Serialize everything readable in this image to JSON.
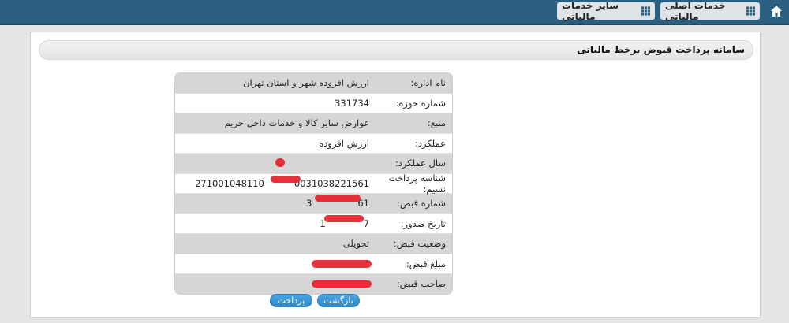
{
  "nav": {
    "main_services": "خدمات اصلی مالیاتی",
    "other_services": "سایر خدمات مالیاتی"
  },
  "panel": {
    "title": "سامانه پرداخت قبوض برخط مالیاتی"
  },
  "fields": [
    {
      "label": "نام اداره:",
      "value": "ارزش افزوده شهر و استان تهران"
    },
    {
      "label": "شماره حوزه:",
      "value": "331734"
    },
    {
      "label": "منبع:",
      "value": "عوارض سایر کالا و خدمات داخل حریم"
    },
    {
      "label": "عملکرد:",
      "value": "ارزش افزوده"
    },
    {
      "label": "سال عملکرد:",
      "value": ""
    },
    {
      "label": "شناسه پرداخت نسیم:",
      "value": "271001048110",
      "value_tail": "0031038221561"
    },
    {
      "label": "شماره قبض:",
      "value": "3",
      "value_tail": "61"
    },
    {
      "label": "تاریخ صدور:",
      "value": "1",
      "value_tail": "7"
    },
    {
      "label": "وضعیت قبض:",
      "value": "تحویلی"
    },
    {
      "label": "مبلغ قبض:",
      "value": ""
    },
    {
      "label": "صاحب قبض:",
      "value": ""
    }
  ],
  "buttons": {
    "back": "بازگشت",
    "pay": "پرداخت"
  },
  "colors": {
    "topbar": "#2a5f7f",
    "button": "#2c86c9",
    "redaction": "#e8202a"
  }
}
